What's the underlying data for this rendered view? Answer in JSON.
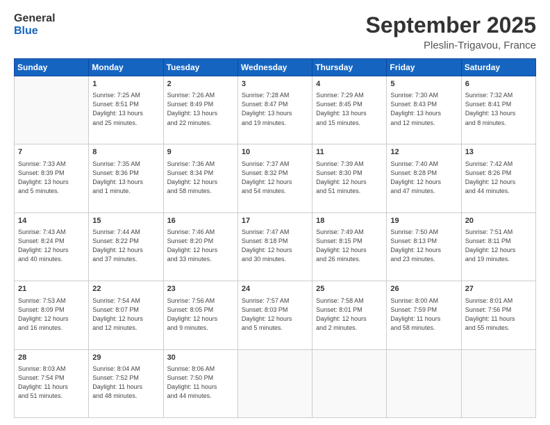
{
  "logo": {
    "line1": "General",
    "line2": "Blue"
  },
  "title": "September 2025",
  "subtitle": "Pleslin-Trigavou, France",
  "days_header": [
    "Sunday",
    "Monday",
    "Tuesday",
    "Wednesday",
    "Thursday",
    "Friday",
    "Saturday"
  ],
  "weeks": [
    [
      {
        "num": "",
        "info": ""
      },
      {
        "num": "1",
        "info": "Sunrise: 7:25 AM\nSunset: 8:51 PM\nDaylight: 13 hours\nand 25 minutes."
      },
      {
        "num": "2",
        "info": "Sunrise: 7:26 AM\nSunset: 8:49 PM\nDaylight: 13 hours\nand 22 minutes."
      },
      {
        "num": "3",
        "info": "Sunrise: 7:28 AM\nSunset: 8:47 PM\nDaylight: 13 hours\nand 19 minutes."
      },
      {
        "num": "4",
        "info": "Sunrise: 7:29 AM\nSunset: 8:45 PM\nDaylight: 13 hours\nand 15 minutes."
      },
      {
        "num": "5",
        "info": "Sunrise: 7:30 AM\nSunset: 8:43 PM\nDaylight: 13 hours\nand 12 minutes."
      },
      {
        "num": "6",
        "info": "Sunrise: 7:32 AM\nSunset: 8:41 PM\nDaylight: 13 hours\nand 8 minutes."
      }
    ],
    [
      {
        "num": "7",
        "info": "Sunrise: 7:33 AM\nSunset: 8:39 PM\nDaylight: 13 hours\nand 5 minutes."
      },
      {
        "num": "8",
        "info": "Sunrise: 7:35 AM\nSunset: 8:36 PM\nDaylight: 13 hours\nand 1 minute."
      },
      {
        "num": "9",
        "info": "Sunrise: 7:36 AM\nSunset: 8:34 PM\nDaylight: 12 hours\nand 58 minutes."
      },
      {
        "num": "10",
        "info": "Sunrise: 7:37 AM\nSunset: 8:32 PM\nDaylight: 12 hours\nand 54 minutes."
      },
      {
        "num": "11",
        "info": "Sunrise: 7:39 AM\nSunset: 8:30 PM\nDaylight: 12 hours\nand 51 minutes."
      },
      {
        "num": "12",
        "info": "Sunrise: 7:40 AM\nSunset: 8:28 PM\nDaylight: 12 hours\nand 47 minutes."
      },
      {
        "num": "13",
        "info": "Sunrise: 7:42 AM\nSunset: 8:26 PM\nDaylight: 12 hours\nand 44 minutes."
      }
    ],
    [
      {
        "num": "14",
        "info": "Sunrise: 7:43 AM\nSunset: 8:24 PM\nDaylight: 12 hours\nand 40 minutes."
      },
      {
        "num": "15",
        "info": "Sunrise: 7:44 AM\nSunset: 8:22 PM\nDaylight: 12 hours\nand 37 minutes."
      },
      {
        "num": "16",
        "info": "Sunrise: 7:46 AM\nSunset: 8:20 PM\nDaylight: 12 hours\nand 33 minutes."
      },
      {
        "num": "17",
        "info": "Sunrise: 7:47 AM\nSunset: 8:18 PM\nDaylight: 12 hours\nand 30 minutes."
      },
      {
        "num": "18",
        "info": "Sunrise: 7:49 AM\nSunset: 8:15 PM\nDaylight: 12 hours\nand 26 minutes."
      },
      {
        "num": "19",
        "info": "Sunrise: 7:50 AM\nSunset: 8:13 PM\nDaylight: 12 hours\nand 23 minutes."
      },
      {
        "num": "20",
        "info": "Sunrise: 7:51 AM\nSunset: 8:11 PM\nDaylight: 12 hours\nand 19 minutes."
      }
    ],
    [
      {
        "num": "21",
        "info": "Sunrise: 7:53 AM\nSunset: 8:09 PM\nDaylight: 12 hours\nand 16 minutes."
      },
      {
        "num": "22",
        "info": "Sunrise: 7:54 AM\nSunset: 8:07 PM\nDaylight: 12 hours\nand 12 minutes."
      },
      {
        "num": "23",
        "info": "Sunrise: 7:56 AM\nSunset: 8:05 PM\nDaylight: 12 hours\nand 9 minutes."
      },
      {
        "num": "24",
        "info": "Sunrise: 7:57 AM\nSunset: 8:03 PM\nDaylight: 12 hours\nand 5 minutes."
      },
      {
        "num": "25",
        "info": "Sunrise: 7:58 AM\nSunset: 8:01 PM\nDaylight: 12 hours\nand 2 minutes."
      },
      {
        "num": "26",
        "info": "Sunrise: 8:00 AM\nSunset: 7:59 PM\nDaylight: 11 hours\nand 58 minutes."
      },
      {
        "num": "27",
        "info": "Sunrise: 8:01 AM\nSunset: 7:56 PM\nDaylight: 11 hours\nand 55 minutes."
      }
    ],
    [
      {
        "num": "28",
        "info": "Sunrise: 8:03 AM\nSunset: 7:54 PM\nDaylight: 11 hours\nand 51 minutes."
      },
      {
        "num": "29",
        "info": "Sunrise: 8:04 AM\nSunset: 7:52 PM\nDaylight: 11 hours\nand 48 minutes."
      },
      {
        "num": "30",
        "info": "Sunrise: 8:06 AM\nSunset: 7:50 PM\nDaylight: 11 hours\nand 44 minutes."
      },
      {
        "num": "",
        "info": ""
      },
      {
        "num": "",
        "info": ""
      },
      {
        "num": "",
        "info": ""
      },
      {
        "num": "",
        "info": ""
      }
    ]
  ]
}
